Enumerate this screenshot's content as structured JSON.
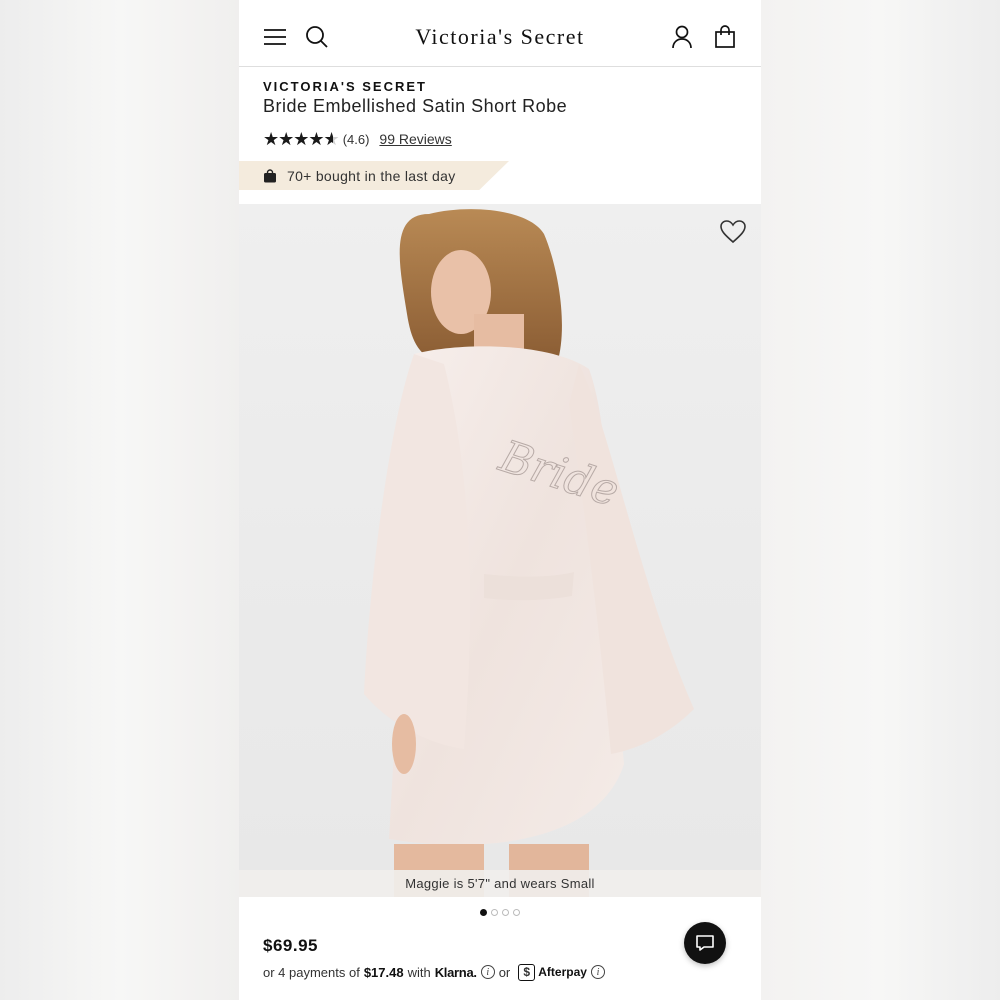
{
  "header": {
    "logo_text": "Victoria's Secret",
    "icons": [
      "menu-icon",
      "search-icon",
      "account-icon",
      "bag-icon"
    ]
  },
  "product": {
    "brand": "VICTORIA'S SECRET",
    "title": "Bride Embellished Satin Short Robe",
    "rating": 4.6,
    "rating_label": "(4.6)",
    "rating_max": 5,
    "reviews_label": "99 Reviews",
    "bought_badge": "70+ bought in the last day",
    "image_caption": "Maggie is 5'7\" and wears Small",
    "image_text": "Bride",
    "carousel": {
      "count": 4,
      "active_index": 0
    },
    "favorited": false
  },
  "pricing": {
    "price": "$69.95",
    "installment_prefix": "or 4 payments of",
    "installment_amount": "$17.48",
    "installment_with": "with",
    "klarna_label": "Klarna.",
    "or_label": "or",
    "afterpay_label": "Afterpay"
  },
  "colors": {
    "text": "#111111",
    "badge_bg": "#f4ebdd",
    "robe": "#f3e9e5",
    "chat_button": "#111111"
  }
}
